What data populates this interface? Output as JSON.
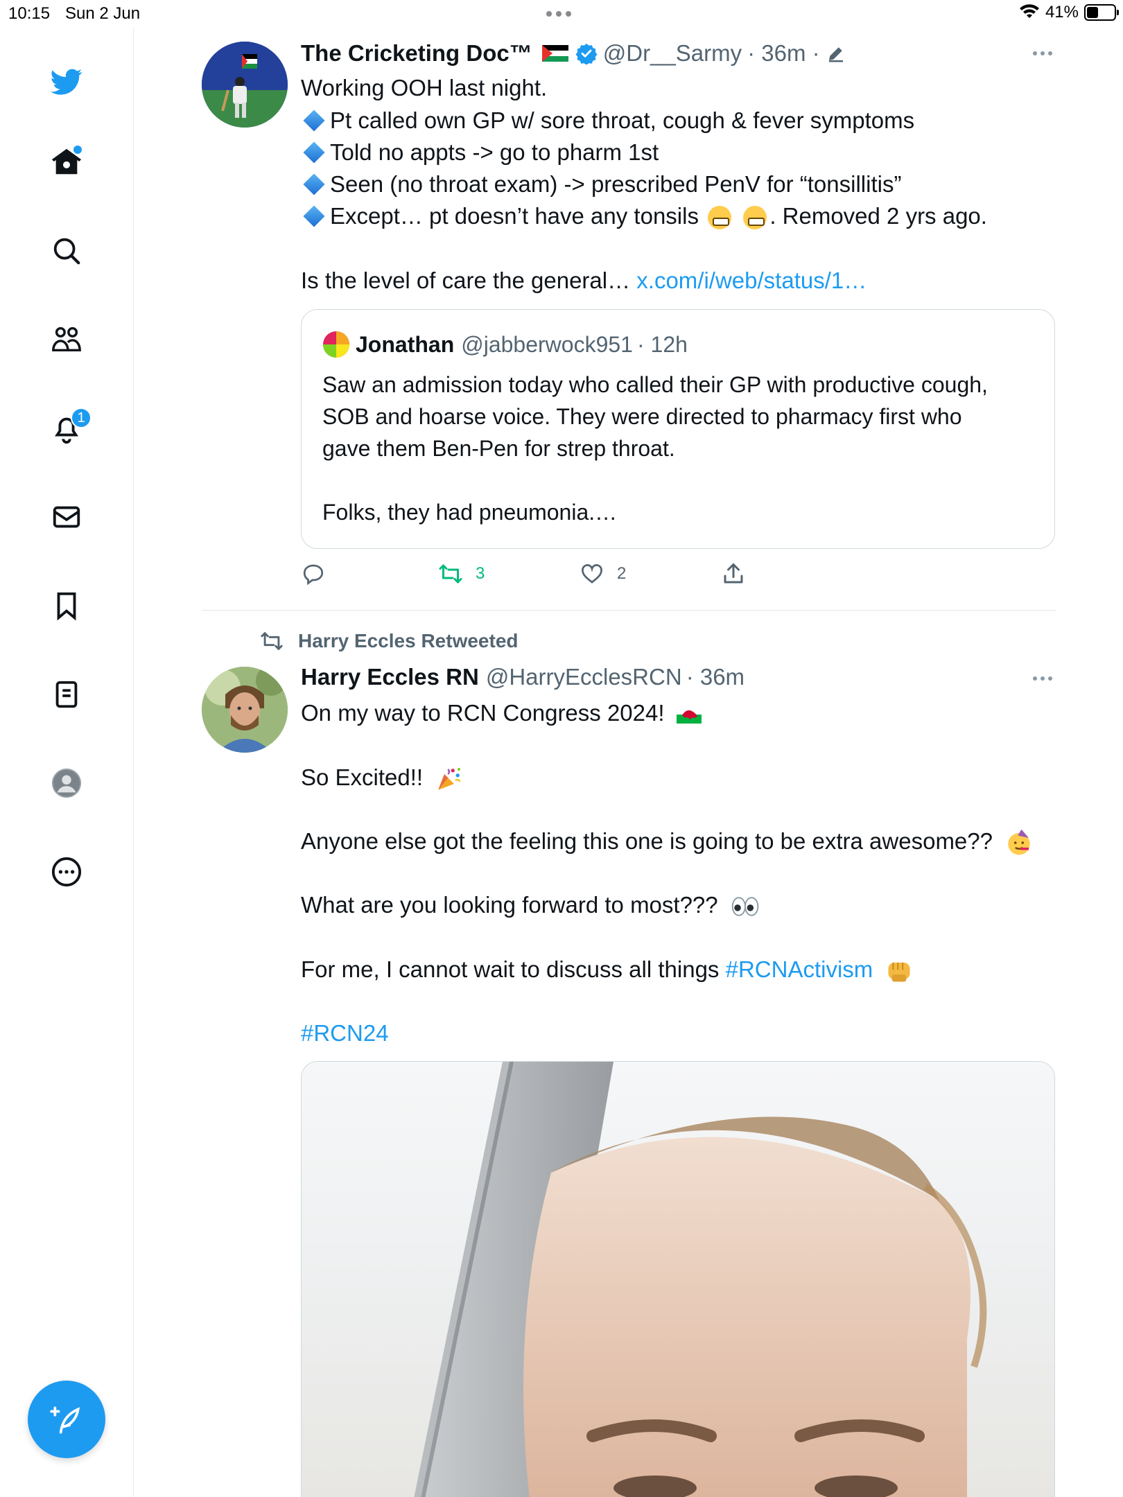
{
  "status_bar": {
    "time": "10:15",
    "date": "Sun 2 Jun",
    "battery": "41%",
    "battery_level": 0.41
  },
  "sidebar": {
    "items": [
      {
        "name": "twitter-logo"
      },
      {
        "name": "home"
      },
      {
        "name": "explore"
      },
      {
        "name": "communities"
      },
      {
        "name": "notifications",
        "badge": "1"
      },
      {
        "name": "messages"
      },
      {
        "name": "bookmarks"
      },
      {
        "name": "lists"
      },
      {
        "name": "profile"
      },
      {
        "name": "more"
      }
    ]
  },
  "tweet1": {
    "name": "The Cricketing Doc™",
    "handle": "@Dr__Sarmy",
    "time": "· 36m ·",
    "lines": [
      "Working OOH last night.",
      "Pt called own GP w/ sore throat, cough & fever symptoms",
      "Told no appts -> go to pharm 1st",
      "Seen (no throat exam) -> prescribed PenV for “tonsillitis”",
      "Except… pt doesn’t have any tonsils",
      ". Removed 2 yrs ago."
    ],
    "truncated_text": "Is the level of care the general…",
    "link": "x.com/i/web/status/1…",
    "quote": {
      "name": "Jonathan",
      "handle": "@jabberwock951",
      "time": "· 12h",
      "lines": [
        "Saw an admission today who called their GP with productive cough,",
        "SOB and hoarse voice. They were directed to pharmacy first who",
        "gave them Ben-Pen for strep throat.",
        "Folks, they had pneumonia.…"
      ]
    },
    "stats": {
      "replies": "",
      "retweets": "3",
      "likes": "2"
    }
  },
  "tweet2": {
    "retweeted_by": "Harry Eccles Retweeted",
    "name": "Harry Eccles RN",
    "handle": "@HarryEcclesRCN",
    "time": "· 36m",
    "lines": [
      "On my way to RCN Congress 2024!",
      "So Excited!!",
      "Anyone else got the feeling this one is going to be extra awesome??",
      "What are you looking forward to most???",
      "For me, I cannot wait to discuss all things",
      "#RCNActivism",
      "#RCN24"
    ]
  },
  "colors": {
    "accent": "#1d9bf0",
    "retweet_green": "#00ba7c",
    "text": "#0f1419",
    "muted": "#536471"
  }
}
